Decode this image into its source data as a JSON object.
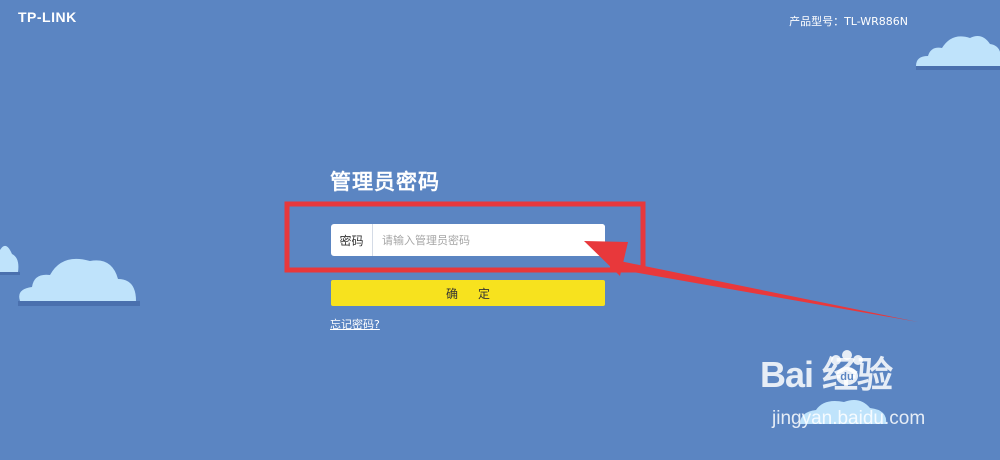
{
  "header": {
    "logo": "TP-LINK",
    "model_text": "产品型号：TL-WR886N"
  },
  "login": {
    "title": "管理员密码",
    "password_label": "密码",
    "password_placeholder": "请输入管理员密码",
    "password_value": "",
    "confirm_label": "确定",
    "forgot_link": "忘记密码?"
  },
  "watermark": {
    "brand": "Bai 经验",
    "url": "jingyan.baidu.com"
  },
  "colors": {
    "background": "#5b85c2",
    "cloud": "#bfe3fb",
    "cloud_shadow": "#4a70ae",
    "confirm_button": "#f7e21e",
    "annotation": "#e8383b"
  }
}
